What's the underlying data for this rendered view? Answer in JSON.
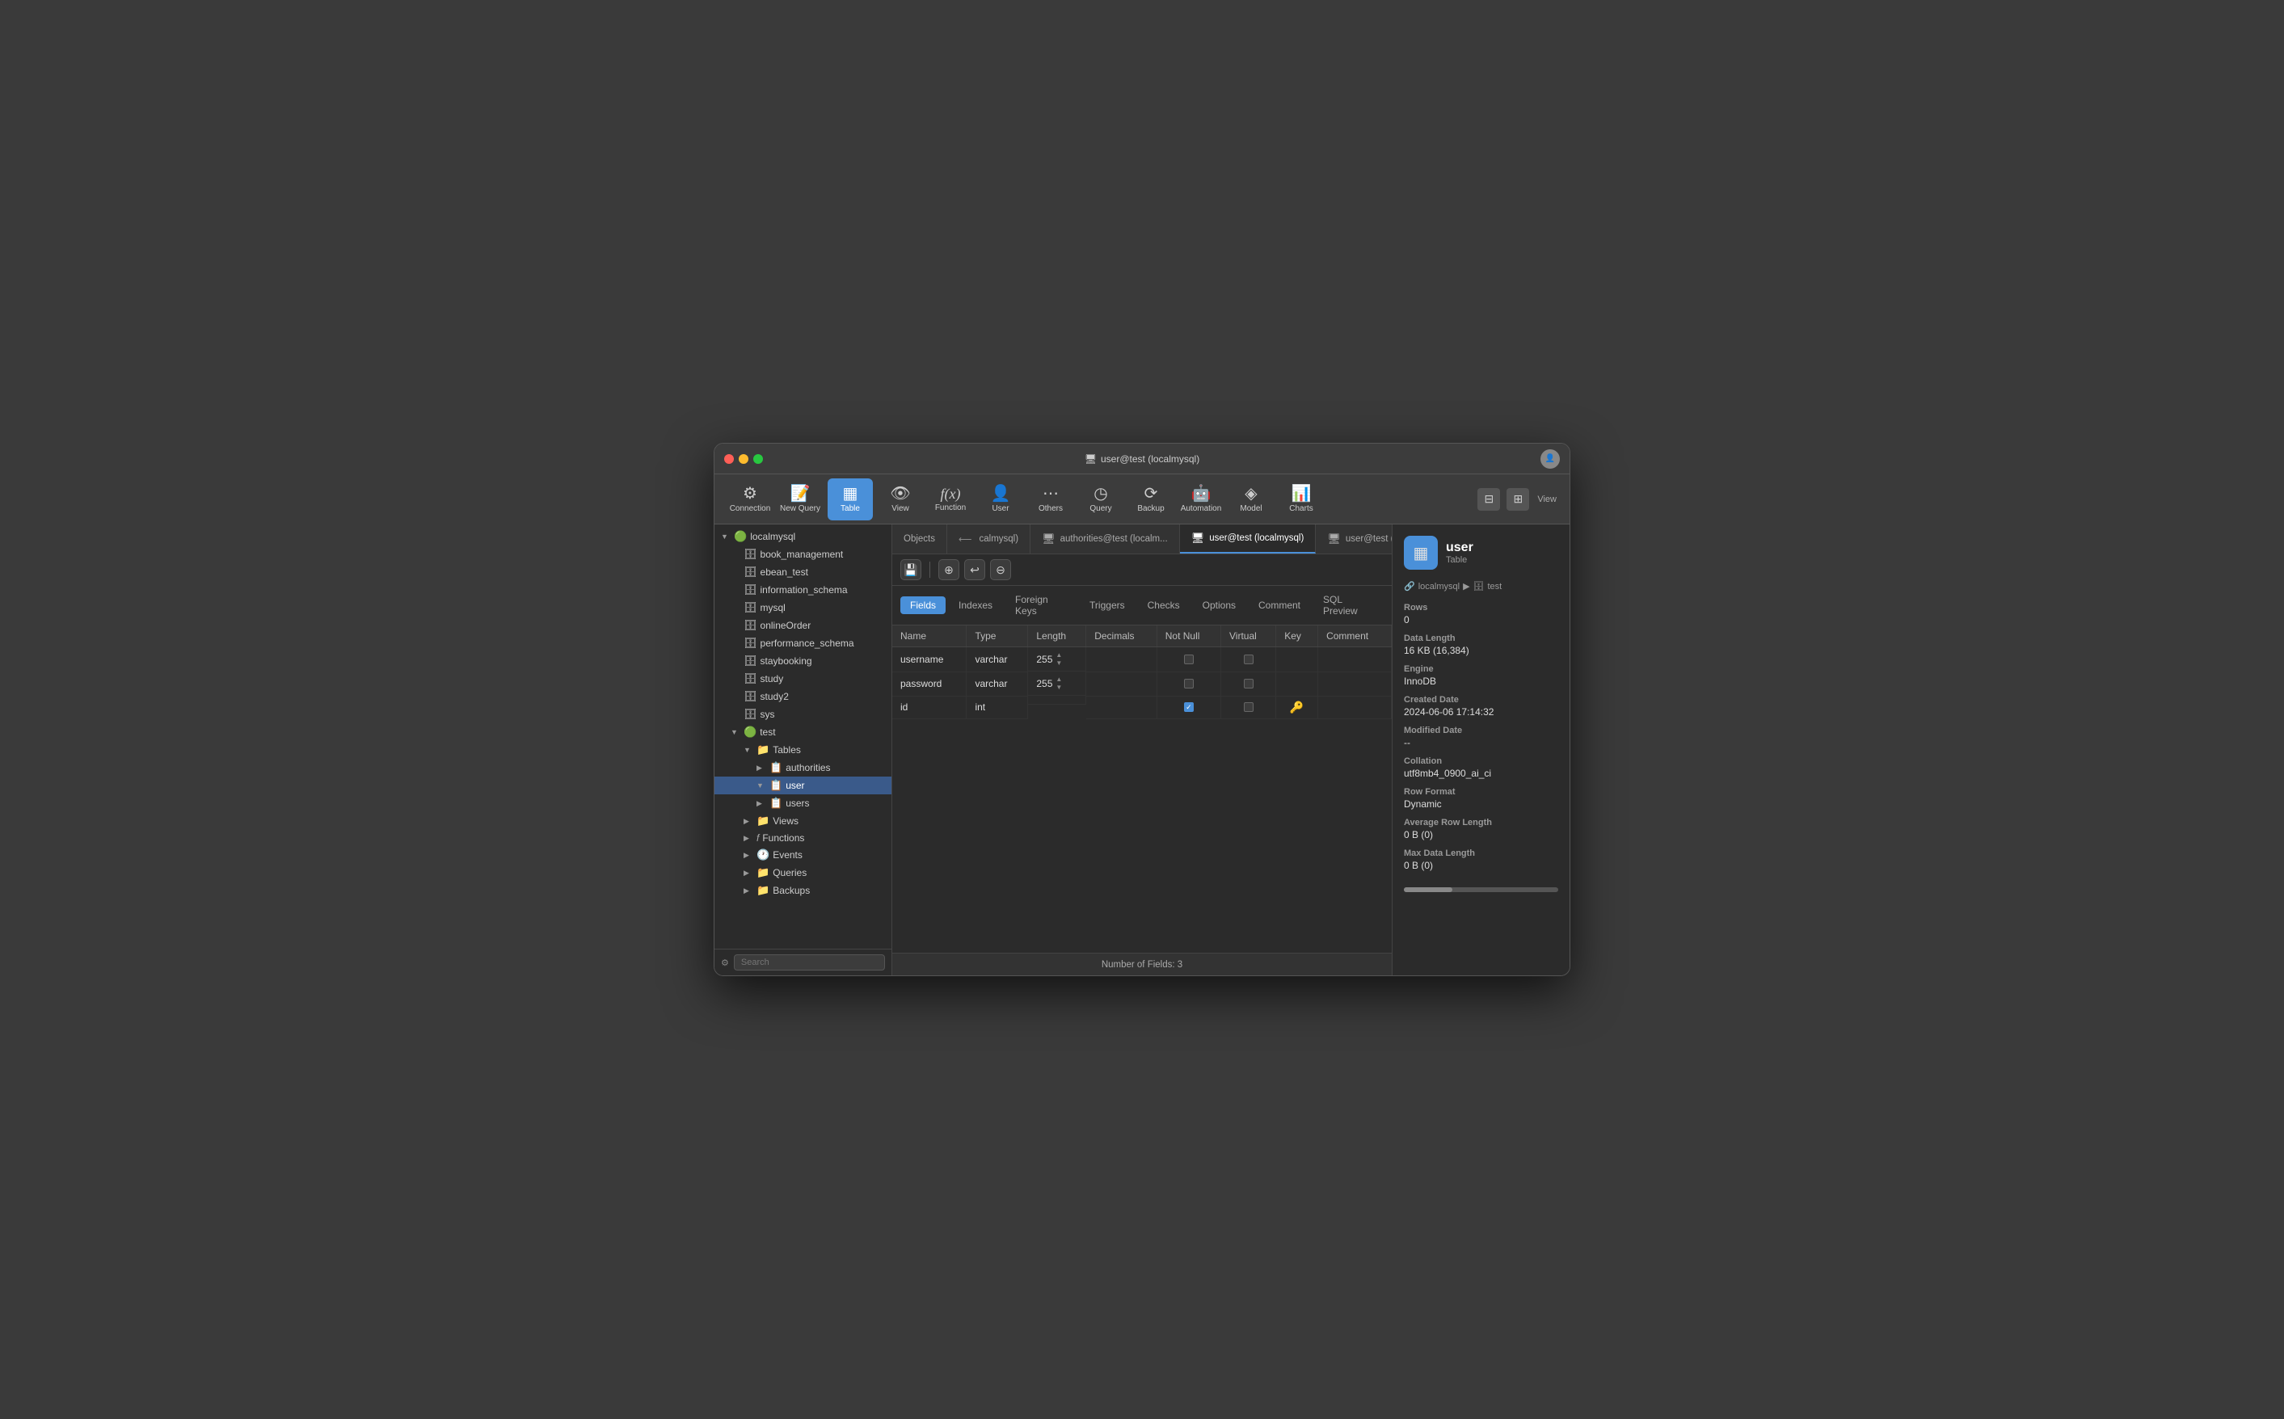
{
  "window": {
    "title": "user@test (localmysql)",
    "title_icon": "🖥"
  },
  "toolbar": {
    "items": [
      {
        "id": "connection",
        "label": "Connection",
        "icon": "⚙"
      },
      {
        "id": "new-query",
        "label": "New Query",
        "icon": "📝"
      },
      {
        "id": "table",
        "label": "Table",
        "icon": "▦",
        "active": true
      },
      {
        "id": "view",
        "label": "View",
        "icon": "👁"
      },
      {
        "id": "function",
        "label": "Function",
        "icon": "𝑓"
      },
      {
        "id": "user",
        "label": "User",
        "icon": "👤"
      },
      {
        "id": "others",
        "label": "Others",
        "icon": "⋯"
      },
      {
        "id": "query",
        "label": "Query",
        "icon": "◷"
      },
      {
        "id": "backup",
        "label": "Backup",
        "icon": "⟳"
      },
      {
        "id": "automation",
        "label": "Automation",
        "icon": "🤖"
      },
      {
        "id": "model",
        "label": "Model",
        "icon": "◈"
      },
      {
        "id": "charts",
        "label": "Charts",
        "icon": "📊"
      }
    ],
    "view_label": "View"
  },
  "tabs": [
    {
      "id": "objects",
      "label": "Objects",
      "icon": "",
      "active": false
    },
    {
      "id": "calmysql",
      "label": "calmysql)",
      "icon": "⟵",
      "active": false
    },
    {
      "id": "authorities",
      "label": "authorities@test (localm...",
      "icon": "🖥",
      "active": false
    },
    {
      "id": "user-test",
      "label": "user@test (localmysql)",
      "icon": "🖥",
      "active": true
    },
    {
      "id": "user-test2",
      "label": "user@test (localmysql)",
      "icon": "🖥",
      "active": false
    }
  ],
  "sub_tabs": [
    {
      "id": "fields",
      "label": "Fields",
      "active": true
    },
    {
      "id": "indexes",
      "label": "Indexes",
      "active": false
    },
    {
      "id": "foreign-keys",
      "label": "Foreign Keys",
      "active": false
    },
    {
      "id": "triggers",
      "label": "Triggers",
      "active": false
    },
    {
      "id": "checks",
      "label": "Checks",
      "active": false
    },
    {
      "id": "options",
      "label": "Options",
      "active": false
    },
    {
      "id": "comment",
      "label": "Comment",
      "active": false
    },
    {
      "id": "sql-preview",
      "label": "SQL Preview",
      "active": false
    }
  ],
  "table_columns": [
    "Name",
    "Type",
    "Length",
    "Decimals",
    "Not Null",
    "Virtual",
    "Key",
    "Comment"
  ],
  "table_rows": [
    {
      "name": "username",
      "type": "varchar",
      "length": "255",
      "decimals": "",
      "not_null": false,
      "virtual": false,
      "key": false,
      "comment": ""
    },
    {
      "name": "password",
      "type": "varchar",
      "length": "255",
      "decimals": "",
      "not_null": false,
      "virtual": false,
      "key": false,
      "comment": ""
    },
    {
      "name": "id",
      "type": "int",
      "length": "",
      "decimals": "",
      "not_null": true,
      "virtual": false,
      "key": true,
      "comment": ""
    }
  ],
  "sidebar": {
    "items": [
      {
        "id": "localmysql",
        "label": "localmysql",
        "icon": "🔵",
        "level": 0,
        "expanded": true,
        "hasArrow": true
      },
      {
        "id": "book-mgmt",
        "label": "book_management",
        "icon": "🗄",
        "level": 1,
        "expanded": false,
        "hasArrow": false
      },
      {
        "id": "ebean",
        "label": "ebean_test",
        "icon": "🗄",
        "level": 1,
        "expanded": false,
        "hasArrow": false
      },
      {
        "id": "info-schema",
        "label": "information_schema",
        "icon": "🗄",
        "level": 1,
        "expanded": false,
        "hasArrow": false
      },
      {
        "id": "mysql",
        "label": "mysql",
        "icon": "🗄",
        "level": 1,
        "expanded": false,
        "hasArrow": false
      },
      {
        "id": "online-order",
        "label": "onlineOrder",
        "icon": "🗄",
        "level": 1,
        "expanded": false,
        "hasArrow": false
      },
      {
        "id": "perf-schema",
        "label": "performance_schema",
        "icon": "🗄",
        "level": 1,
        "expanded": false,
        "hasArrow": false
      },
      {
        "id": "staybooking",
        "label": "staybooking",
        "icon": "🗄",
        "level": 1,
        "expanded": false,
        "hasArrow": false
      },
      {
        "id": "study",
        "label": "study",
        "icon": "🗄",
        "level": 1,
        "expanded": false,
        "hasArrow": false
      },
      {
        "id": "study2",
        "label": "study2",
        "icon": "🗄",
        "level": 1,
        "expanded": false,
        "hasArrow": false
      },
      {
        "id": "sys",
        "label": "sys",
        "icon": "🗄",
        "level": 1,
        "expanded": false,
        "hasArrow": false
      },
      {
        "id": "test",
        "label": "test",
        "icon": "🔵",
        "level": 1,
        "expanded": true,
        "hasArrow": true
      },
      {
        "id": "tables",
        "label": "Tables",
        "icon": "📁",
        "level": 2,
        "expanded": true,
        "hasArrow": true
      },
      {
        "id": "authorities",
        "label": "authorities",
        "icon": "📋",
        "level": 3,
        "expanded": false,
        "hasArrow": true
      },
      {
        "id": "user",
        "label": "user",
        "icon": "📋",
        "level": 3,
        "expanded": true,
        "hasArrow": true,
        "selected": true
      },
      {
        "id": "users",
        "label": "users",
        "icon": "📋",
        "level": 3,
        "expanded": false,
        "hasArrow": true
      },
      {
        "id": "views",
        "label": "Views",
        "icon": "📁",
        "level": 2,
        "expanded": false,
        "hasArrow": true
      },
      {
        "id": "functions",
        "label": "Functions",
        "icon": "📁",
        "level": 2,
        "expanded": false,
        "hasArrow": true
      },
      {
        "id": "events",
        "label": "Events",
        "icon": "📁",
        "level": 2,
        "expanded": false,
        "hasArrow": true
      },
      {
        "id": "queries",
        "label": "Queries",
        "icon": "📁",
        "level": 2,
        "expanded": false,
        "hasArrow": true
      },
      {
        "id": "backups",
        "label": "Backups",
        "icon": "📁",
        "level": 2,
        "expanded": false,
        "hasArrow": true
      }
    ],
    "search_placeholder": "Search"
  },
  "right_panel": {
    "title": "user",
    "subtitle": "Table",
    "breadcrumb_db": "localmysql",
    "breadcrumb_schema": "test",
    "rows_label": "Rows",
    "rows_value": "0",
    "data_length_label": "Data Length",
    "data_length_value": "16 KB (16,384)",
    "engine_label": "Engine",
    "engine_value": "InnoDB",
    "created_date_label": "Created Date",
    "created_date_value": "2024-06-06 17:14:32",
    "modified_date_label": "Modified Date",
    "modified_date_value": "--",
    "collation_label": "Collation",
    "collation_value": "utf8mb4_0900_ai_ci",
    "row_format_label": "Row Format",
    "row_format_value": "Dynamic",
    "avg_row_label": "Average Row Length",
    "avg_row_value": "0 B (0)",
    "max_data_label": "Max Data Length",
    "max_data_value": "0 B (0)"
  },
  "statusbar": {
    "text": "Number of Fields: 3"
  }
}
